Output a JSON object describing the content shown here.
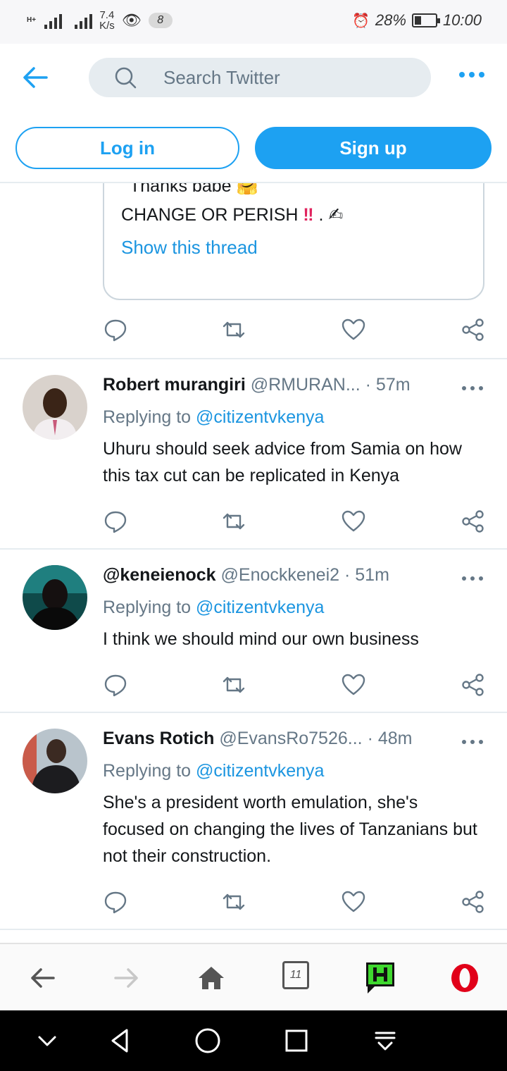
{
  "status_bar": {
    "net_type": "H+",
    "speed_value": "7.4",
    "speed_unit": "K/s",
    "notification_count": "8",
    "battery": "28%",
    "time": "10:00"
  },
  "header": {
    "search_placeholder": "Search Twitter",
    "login_label": "Log in",
    "signup_label": "Sign up"
  },
  "quoted": {
    "partial_line": "Thanks babe",
    "line2": "CHANGE OR PERISH",
    "bangs": "‼",
    "line2_suffix": ".",
    "show_thread": "Show this thread"
  },
  "tweets": [
    {
      "name": "Robert murangiri",
      "handle": "@RMURAN...",
      "time": "· 57m",
      "replying_label": "Replying to",
      "replying_to": "@citizentvkenya",
      "text": "Uhuru should seek advice from Samia on how this tax cut can be replicated in Kenya"
    },
    {
      "name": "@keneienock",
      "handle": "@Enockkenei2",
      "time": "· 51m",
      "replying_label": "Replying to",
      "replying_to": "@citizentvkenya",
      "text": "I think we should mind our own business"
    },
    {
      "name": "Evans Rotich",
      "handle": "@EvansRo7526...",
      "time": "· 48m",
      "replying_label": "Replying to",
      "replying_to": "@citizentvkenya",
      "text": "She's a president worth emulation, she's focused on changing the lives of Tanzanians but not their construction."
    }
  ],
  "browser_bar": {
    "tab_count": "11"
  },
  "colors": {
    "twitter_blue": "#1da1f2",
    "link_blue": "#1b95e0",
    "muted_gray": "#657786",
    "divider": "#e6ecf0",
    "opera_red": "#e10019",
    "app_green": "#3fd82f"
  },
  "icons": [
    "back-arrow-icon",
    "search-icon",
    "more-icon",
    "reply-icon",
    "retweet-icon",
    "like-icon",
    "share-icon",
    "home-icon",
    "tabs-icon",
    "opera-icon"
  ]
}
